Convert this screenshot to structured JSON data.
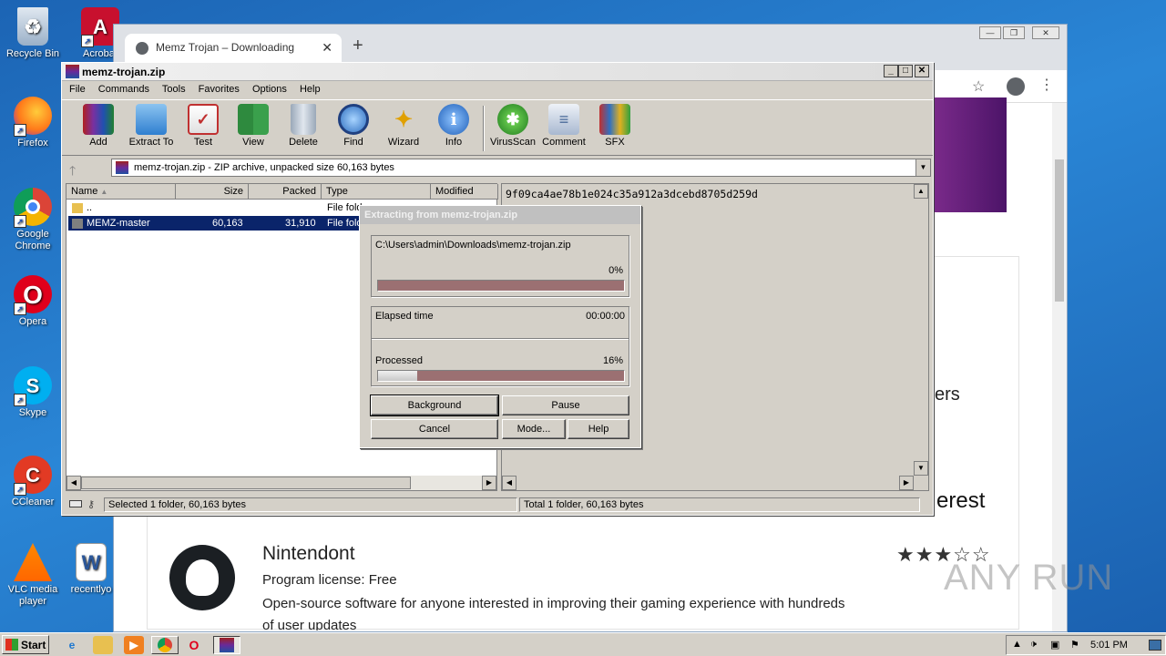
{
  "desktop": {
    "icons": [
      {
        "label": "Recycle Bin",
        "icon": "recycle-bin-icon"
      },
      {
        "label": "Acrobat",
        "icon": "acrobat-icon"
      },
      {
        "label": "Firefox",
        "icon": "firefox-icon"
      },
      {
        "label": "Google Chrome",
        "icon": "chrome-icon"
      },
      {
        "label": "Opera",
        "icon": "opera-icon"
      },
      {
        "label": "Skype",
        "icon": "skype-icon"
      },
      {
        "label": "CCleaner",
        "icon": "ccleaner-icon"
      },
      {
        "label": "VLC media player",
        "icon": "vlc-icon"
      },
      {
        "label": "recentlyo",
        "icon": "word-icon"
      }
    ]
  },
  "browser": {
    "tab_title": "Memz Trojan – Downloading",
    "page": {
      "partial_text_1": "ers",
      "partial_text_2": "erest",
      "app_name": "Nintendont",
      "license": "Program license: Free",
      "description": "Open-source software for anyone interested in improving their gaming experience with hundreds",
      "description_2": "of user updates",
      "rating": 3,
      "rating_max": 5,
      "stars": "★★★☆☆"
    }
  },
  "winrar": {
    "title": "memz-trojan.zip",
    "menu": [
      "File",
      "Commands",
      "Tools",
      "Favorites",
      "Options",
      "Help"
    ],
    "toolbar": [
      "Add",
      "Extract To",
      "Test",
      "View",
      "Delete",
      "Find",
      "Wizard",
      "Info",
      "VirusScan",
      "Comment",
      "SFX"
    ],
    "address": "memz-trojan.zip - ZIP archive, unpacked size 60,163 bytes",
    "columns": [
      "Name",
      "Size",
      "Packed",
      "Type",
      "Modified"
    ],
    "rows": [
      {
        "name": "..",
        "size": "",
        "packed": "",
        "type": "File fold"
      },
      {
        "name": "MEMZ-master",
        "size": "60,163",
        "packed": "31,910",
        "type": "File fold"
      }
    ],
    "hash": "9f09ca4ae78b1e024c35a912a3dcebd8705d259d",
    "status_left": "Selected 1 folder, 60,163 bytes",
    "status_right": "Total 1 folder, 60,163 bytes"
  },
  "dialog": {
    "title": "Extracting from memz-trojan.zip",
    "path": "C:\\Users\\admin\\Downloads\\memz-trojan.zip",
    "file_percent": "0%",
    "file_progress": 0,
    "elapsed_label": "Elapsed time",
    "elapsed_value": "00:00:00",
    "processed_label": "Processed",
    "processed_percent": "16%",
    "processed_progress": 0.16,
    "buttons": {
      "background": "Background",
      "pause": "Pause",
      "cancel": "Cancel",
      "mode": "Mode...",
      "help": "Help"
    }
  },
  "taskbar": {
    "start": "Start",
    "clock": "5:01 PM"
  },
  "watermark": "ANY RUN"
}
